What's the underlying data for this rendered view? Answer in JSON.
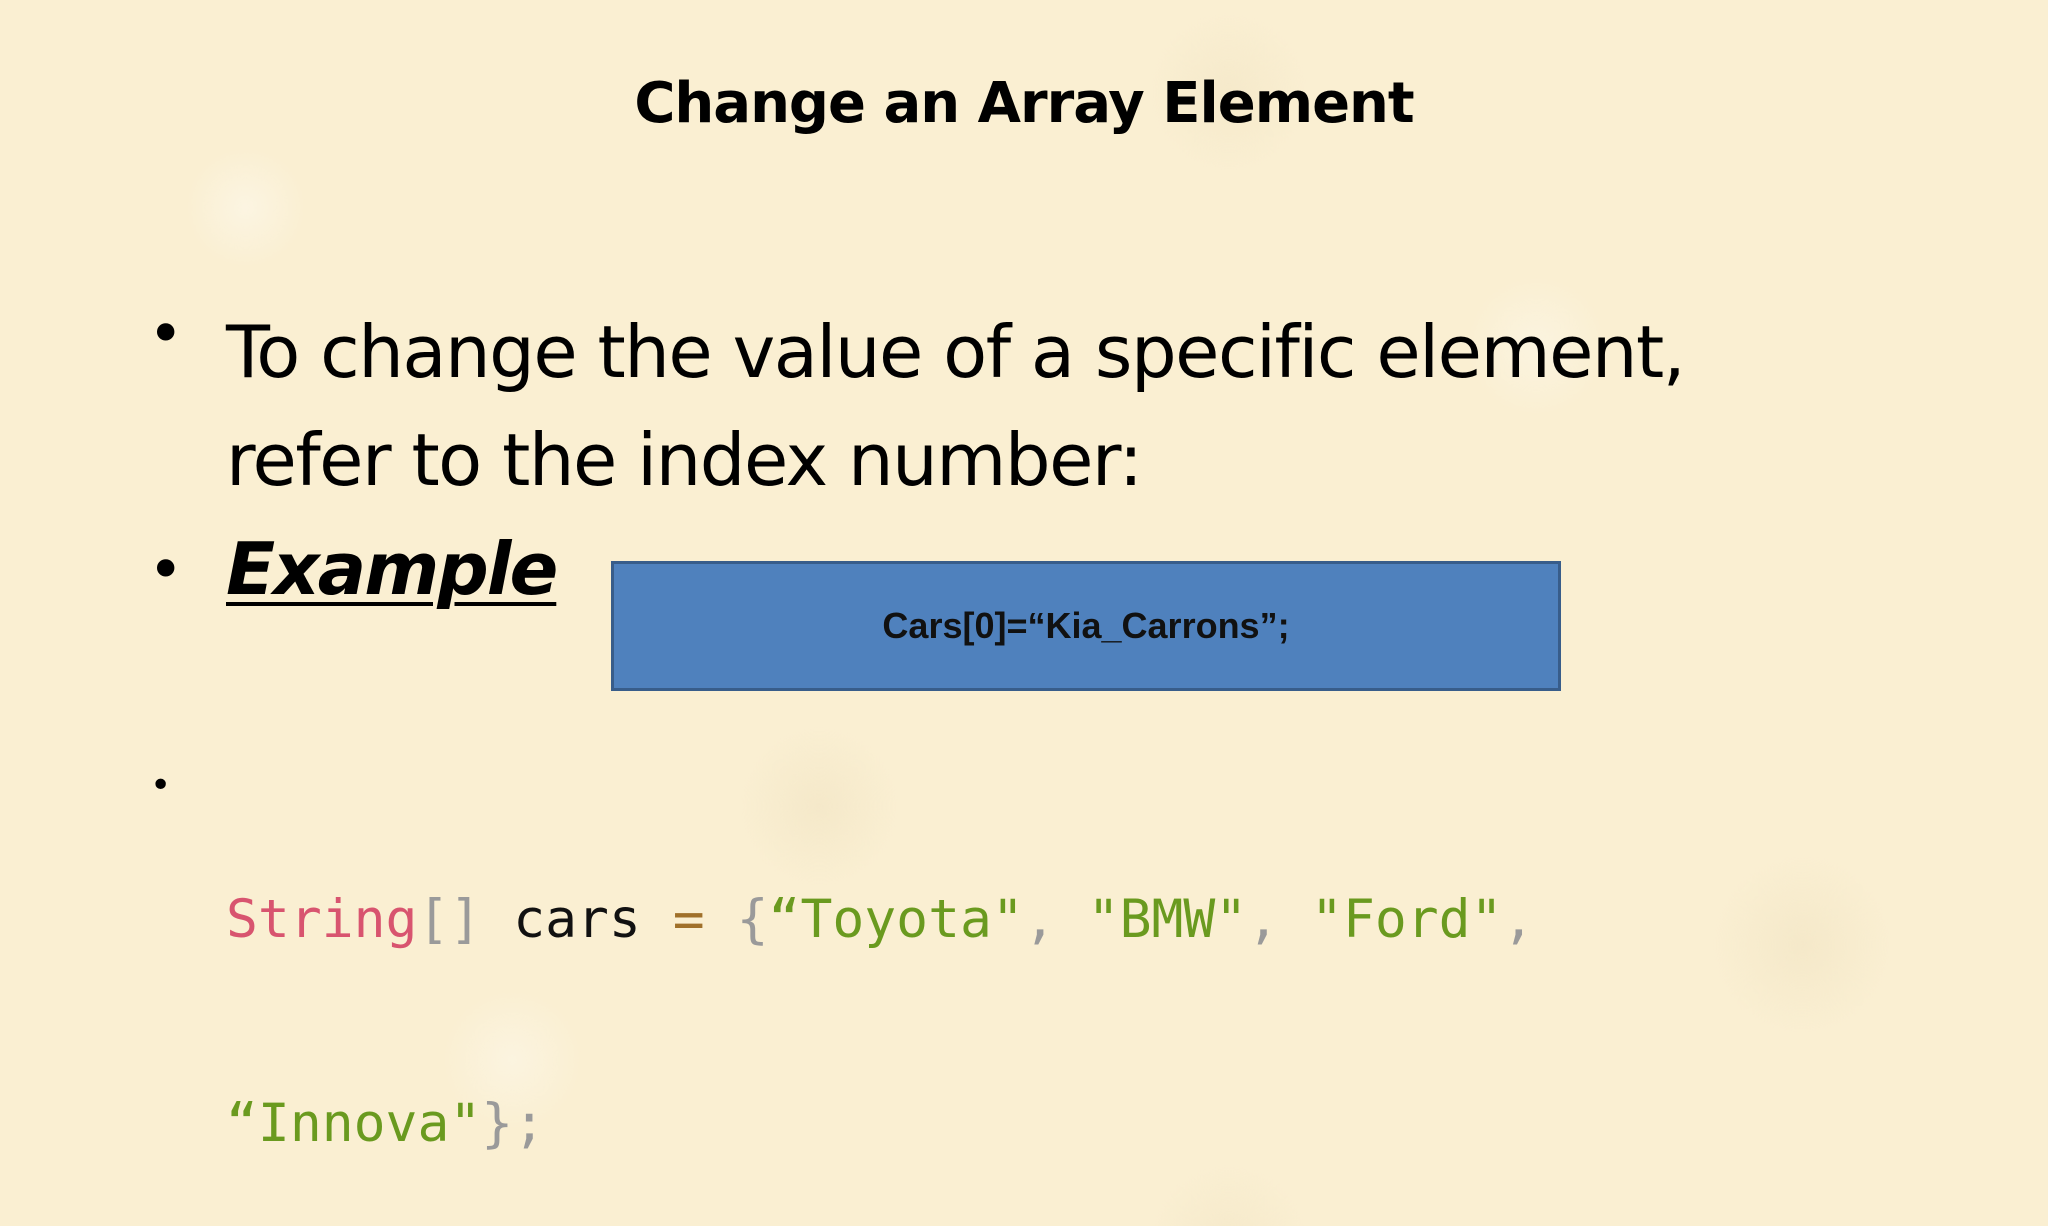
{
  "slide": {
    "title": "Change an Array Element",
    "bullets": {
      "first_line1": "To change the value of a specific element,",
      "first_line2": "refer to the index number:",
      "second": "Example",
      "bullet_glyph": "•"
    },
    "callout": {
      "text": "Cars[0]=“Kia_Carrons”;"
    },
    "code": {
      "type_kw": "String",
      "brackets": "[]",
      "var": "cars",
      "assign": "=",
      "open_brace": "{",
      "str1": "“Toyota\"",
      "comma": ",",
      "str2": "\"BMW\"",
      "str3": "\"Ford\"",
      "str4": "“Innova\"",
      "close": "};"
    }
  },
  "colors": {
    "background": "#faefd2",
    "callout_fill": "#4f81bd",
    "callout_border": "#385d8a",
    "keyword": "#d8546f",
    "string": "#6a9a1f",
    "operator": "#a0702a",
    "punctuation": "#9a9a9a"
  }
}
